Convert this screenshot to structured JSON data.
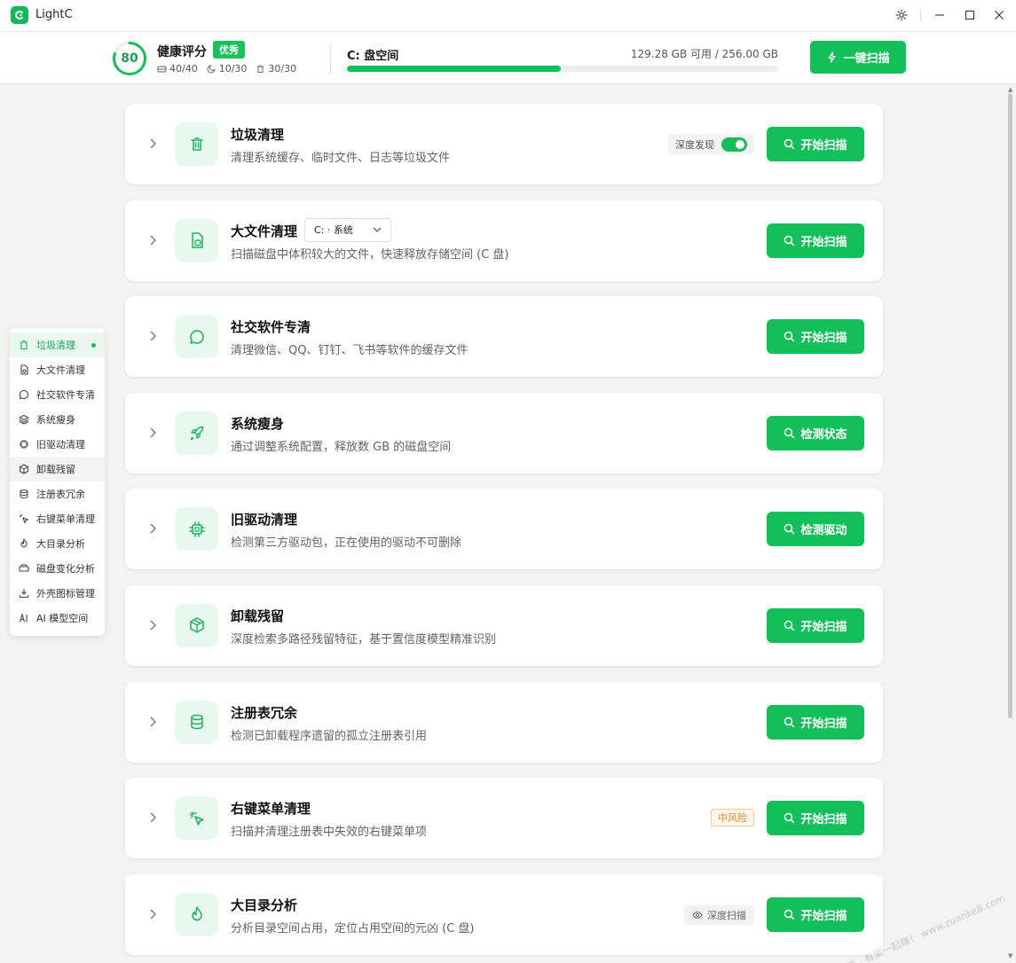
{
  "window": {
    "app_title": "LightC"
  },
  "header": {
    "health_score": "80",
    "health_label": "健康评分",
    "health_badge": "优秀",
    "stats": [
      "40/40",
      "10/30",
      "30/30"
    ],
    "disk_label": "C: 盘空间",
    "disk_free": "129.28 GB 可用 / 256.00 GB",
    "disk_used_fraction": 0.495,
    "onekey_label": "一键扫描"
  },
  "sidenav": {
    "items": [
      {
        "label": "垃圾清理",
        "icon": "trash-icon"
      },
      {
        "label": "大文件清理",
        "icon": "file-box-icon"
      },
      {
        "label": "社交软件专清",
        "icon": "chat-icon"
      },
      {
        "label": "系统瘦身",
        "icon": "layers-icon"
      },
      {
        "label": "旧驱动清理",
        "icon": "chip-icon"
      },
      {
        "label": "卸载残留",
        "icon": "package-icon"
      },
      {
        "label": "注册表冗余",
        "icon": "database-icon"
      },
      {
        "label": "右键菜单清理",
        "icon": "pointer-click-icon"
      },
      {
        "label": "大目录分析",
        "icon": "flame-icon"
      },
      {
        "label": "磁盘变化分析",
        "icon": "drive-icon"
      },
      {
        "label": "外壳图标管理",
        "icon": "download-tray-icon"
      },
      {
        "label": "AI 模型空间",
        "icon": "ai-icon"
      }
    ]
  },
  "cards": [
    {
      "title": "垃圾清理",
      "desc": "清理系统缓存、临时文件、日志等垃圾文件",
      "button": "开始扫描",
      "icon": "trash-icon",
      "toggle_label": "深度发现"
    },
    {
      "title": "大文件清理",
      "desc": "扫描磁盘中体积较大的文件，快速释放存储空间 (C 盘)",
      "button": "开始扫描",
      "icon": "file-box-icon",
      "select_value": "C: · 系统"
    },
    {
      "title": "社交软件专清",
      "desc": "清理微信、QQ、钉钉、飞书等软件的缓存文件",
      "button": "开始扫描",
      "icon": "chat-icon"
    },
    {
      "title": "系统瘦身",
      "desc": "通过调整系统配置，释放数 GB 的磁盘空间",
      "button": "检测状态",
      "icon": "rocket-icon"
    },
    {
      "title": "旧驱动清理",
      "desc": "检测第三方驱动包，正在使用的驱动不可删除",
      "button": "检测驱动",
      "icon": "chip-icon"
    },
    {
      "title": "卸载残留",
      "desc": "深度检索多路径残留特征，基于置信度模型精准识别",
      "button": "开始扫描",
      "icon": "package-icon"
    },
    {
      "title": "注册表冗余",
      "desc": "检测已卸载程序遗留的孤立注册表引用",
      "button": "开始扫描",
      "icon": "database-icon"
    },
    {
      "title": "右键菜单清理",
      "desc": "扫描并清理注册表中失效的右键菜单项",
      "button": "开始扫描",
      "icon": "pointer-click-icon",
      "risk_label": "中风险"
    },
    {
      "title": "大目录分析",
      "desc": "分析目录空间占用，定位占用空间的元凶 (C 盘)",
      "button": "开始扫描",
      "icon": "flame-icon",
      "chip_label": "深度扫描"
    }
  ],
  "watermark": "赚客吧，有奖一起赚！ www.zuanke8.com",
  "colors": {
    "accent": "#13bf59",
    "accent_light": "#e9f8ef",
    "risk": "#e58a2e"
  }
}
